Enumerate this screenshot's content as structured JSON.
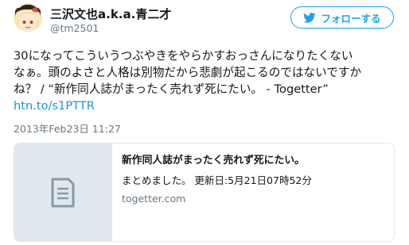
{
  "user": {
    "display_name": "三沢文也a.k.a.青二才",
    "screen_name": "@tm2501"
  },
  "follow_button": {
    "label": "フォローする",
    "icon": "twitter-bird-icon"
  },
  "tweet": {
    "line1": "30になってこういうつぶやきをやらかすおっさんになりたくない",
    "line2": "なぁ。頭のよさと人格は別物だから悲劇が起こるのではないですか",
    "line3": "ね？ / “新作同人誌がまったく売れず死にたい。 - Togetter”",
    "link": "htn.to/s1PTTR",
    "timestamp": "2013年Feb23日 11:27"
  },
  "card": {
    "icon": "document-icon",
    "title": "新作同人誌がまったく売れず死にたい。",
    "description": "まとめました。 更新日:5月21日07時52分",
    "domain": "togetter.com"
  },
  "colors": {
    "accent": "#1da1f2",
    "link": "#1b95e0",
    "muted": "#657786",
    "border": "#e1e8ed"
  }
}
